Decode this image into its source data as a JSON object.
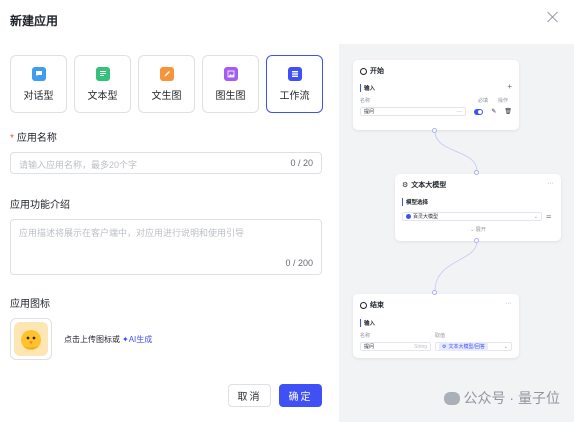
{
  "dialog": {
    "title": "新建应用"
  },
  "app_types": [
    {
      "label": "对话型",
      "icon": "chat-icon",
      "color": "#3f9cf0",
      "active": false
    },
    {
      "label": "文本型",
      "icon": "text-doc-icon",
      "color": "#34c27a",
      "active": false
    },
    {
      "label": "文生图",
      "icon": "brush-icon",
      "color": "#f5953b",
      "active": false
    },
    {
      "label": "图生图",
      "icon": "image-icon",
      "color": "#a35ef0",
      "active": false
    },
    {
      "label": "工作流",
      "icon": "workflow-icon",
      "color": "#3f51f5",
      "active": true
    }
  ],
  "form": {
    "name_label": "应用名称",
    "name_placeholder": "请输入应用名称，最多20个字",
    "name_count": "0 / 20",
    "desc_label": "应用功能介绍",
    "desc_placeholder": "应用描述将展示在客户端中，对应用进行说明和使用引导",
    "desc_count": "0 / 200",
    "icon_label": "应用图标",
    "upload_hint": "点击上传图标或",
    "ai_generate": "✦AI生成"
  },
  "buttons": {
    "cancel": "取消",
    "confirm": "确定"
  },
  "preview": {
    "start_node": {
      "title": "开始",
      "section": "输入",
      "col_name": "名称",
      "col_required": "必填",
      "col_action": "操作",
      "row_name": "提问"
    },
    "llm_node": {
      "title": "文本大模型",
      "section": "模型选择",
      "model": "百灵大模型",
      "expand": "展开"
    },
    "end_node": {
      "title": "结束",
      "section": "输入",
      "col_name": "名称",
      "col_value": "取值",
      "row_name": "提问",
      "row_type": "String",
      "row_value": "文本大模型/回答"
    }
  },
  "watermark": {
    "text": "公众号 · 量子位"
  }
}
